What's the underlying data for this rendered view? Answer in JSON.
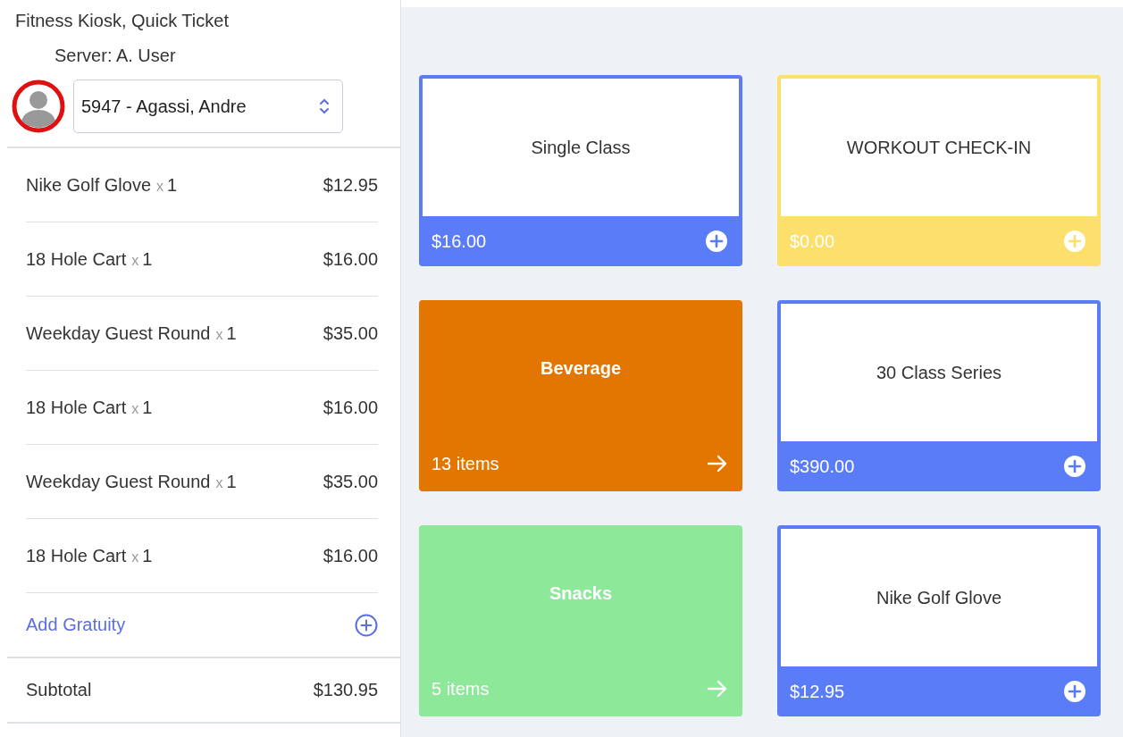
{
  "header": {
    "title": "Fitness Kiosk, Quick Ticket",
    "server": "Server: A. User"
  },
  "customer": {
    "value": "5947 - Agassi, Andre"
  },
  "order_items": [
    {
      "name": "Nike Golf Glove",
      "multiplier": "x",
      "quantity": "1",
      "price": "$12.95"
    },
    {
      "name": "18 Hole Cart",
      "multiplier": "x",
      "quantity": "1",
      "price": "$16.00"
    },
    {
      "name": "Weekday Guest Round",
      "multiplier": "x",
      "quantity": "1",
      "price": "$35.00"
    },
    {
      "name": "18 Hole Cart",
      "multiplier": "x",
      "quantity": "1",
      "price": "$16.00"
    },
    {
      "name": "Weekday Guest Round",
      "multiplier": "x",
      "quantity": "1",
      "price": "$35.00"
    },
    {
      "name": "18 Hole Cart",
      "multiplier": "x",
      "quantity": "1",
      "price": "$16.00"
    }
  ],
  "gratuity": {
    "label": "Add Gratuity"
  },
  "subtotal": {
    "label": "Subtotal",
    "amount": "$130.95"
  },
  "tiles": [
    {
      "kind": "product",
      "name": "Single Class",
      "footer": "$16.00",
      "color": "#5b7cf7"
    },
    {
      "kind": "product",
      "name": "WORKOUT CHECK-IN",
      "footer": "$0.00",
      "color": "#fddf6b"
    },
    {
      "kind": "category",
      "name": "Beverage",
      "footer": "13 items",
      "color": "#e27600"
    },
    {
      "kind": "product",
      "name": "30 Class Series",
      "footer": "$390.00",
      "color": "#5b7cf7"
    },
    {
      "kind": "category",
      "name": "Snacks",
      "footer": "5 items",
      "color": "#8ee89a"
    },
    {
      "kind": "product",
      "name": "Nike Golf Glove",
      "footer": "$12.95",
      "color": "#5b7cf7"
    }
  ]
}
